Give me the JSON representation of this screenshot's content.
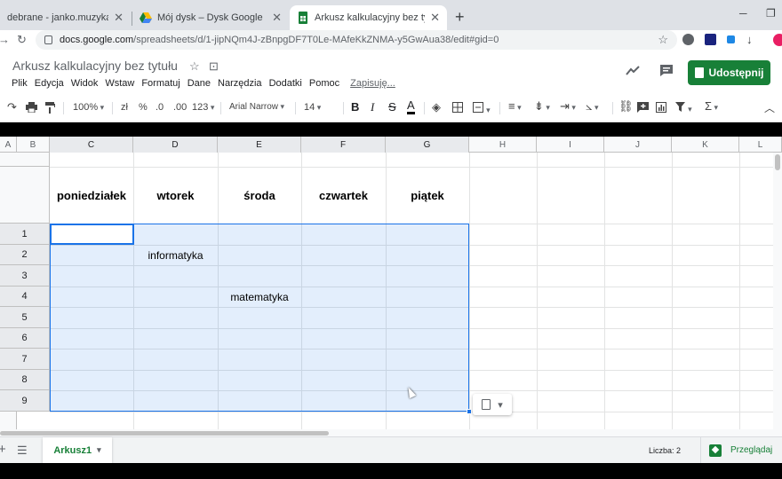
{
  "browser": {
    "tabs": [
      {
        "title": "debrane - janko.muzykant@sp",
        "active": false
      },
      {
        "title": "Mój dysk – Dysk Google",
        "active": false
      },
      {
        "title": "Arkusz kalkulacyjny bez tytułu - ",
        "active": true
      }
    ],
    "newtab_icon": "+",
    "url_host": "docs.google.com",
    "url_path": "/spreadsheets/d/1-jipNQm4J-zBnpgDF7T0Le-MAfeKkZNMA-y5GwAua38/edit#gid=0"
  },
  "doc": {
    "title": "Arkusz kalkulacyjny bez tytułu",
    "menu": [
      "Plik",
      "Edycja",
      "Widok",
      "Wstaw",
      "Formatuj",
      "Dane",
      "Narzędzia",
      "Dodatki",
      "Pomoc"
    ],
    "saving_status": "Zapisuję...",
    "share_label": "Udostępnij",
    "accent_color": "#188038"
  },
  "toolbar": {
    "zoom": "100%",
    "currency": "zł",
    "percent": "%",
    "decrease_decimals": ".0",
    "increase_decimals": ".00",
    "more_formats": "123",
    "font": "Arial Narrow",
    "font_size": "14",
    "bold": "B",
    "italic": "I",
    "strikethrough": "S",
    "text_color": "A",
    "functions": "Σ"
  },
  "grid": {
    "column_headers": [
      "A",
      "B",
      "C",
      "D",
      "E",
      "F",
      "G",
      "H",
      "I",
      "J",
      "K",
      "L"
    ],
    "day_headers": [
      "poniedziałek",
      "wtorek",
      "środa",
      "czwartek",
      "piątek"
    ],
    "row_numbers": [
      "1",
      "2",
      "3",
      "4",
      "5",
      "6",
      "7",
      "8",
      "9"
    ],
    "cells": {
      "D2": "informatyka",
      "E4": "matematyka"
    },
    "selection_color": "#1a73e8"
  },
  "footer": {
    "sheet_name": "Arkusz1",
    "status": "Liczba: 2",
    "explore_label": "Przeglądaj"
  }
}
